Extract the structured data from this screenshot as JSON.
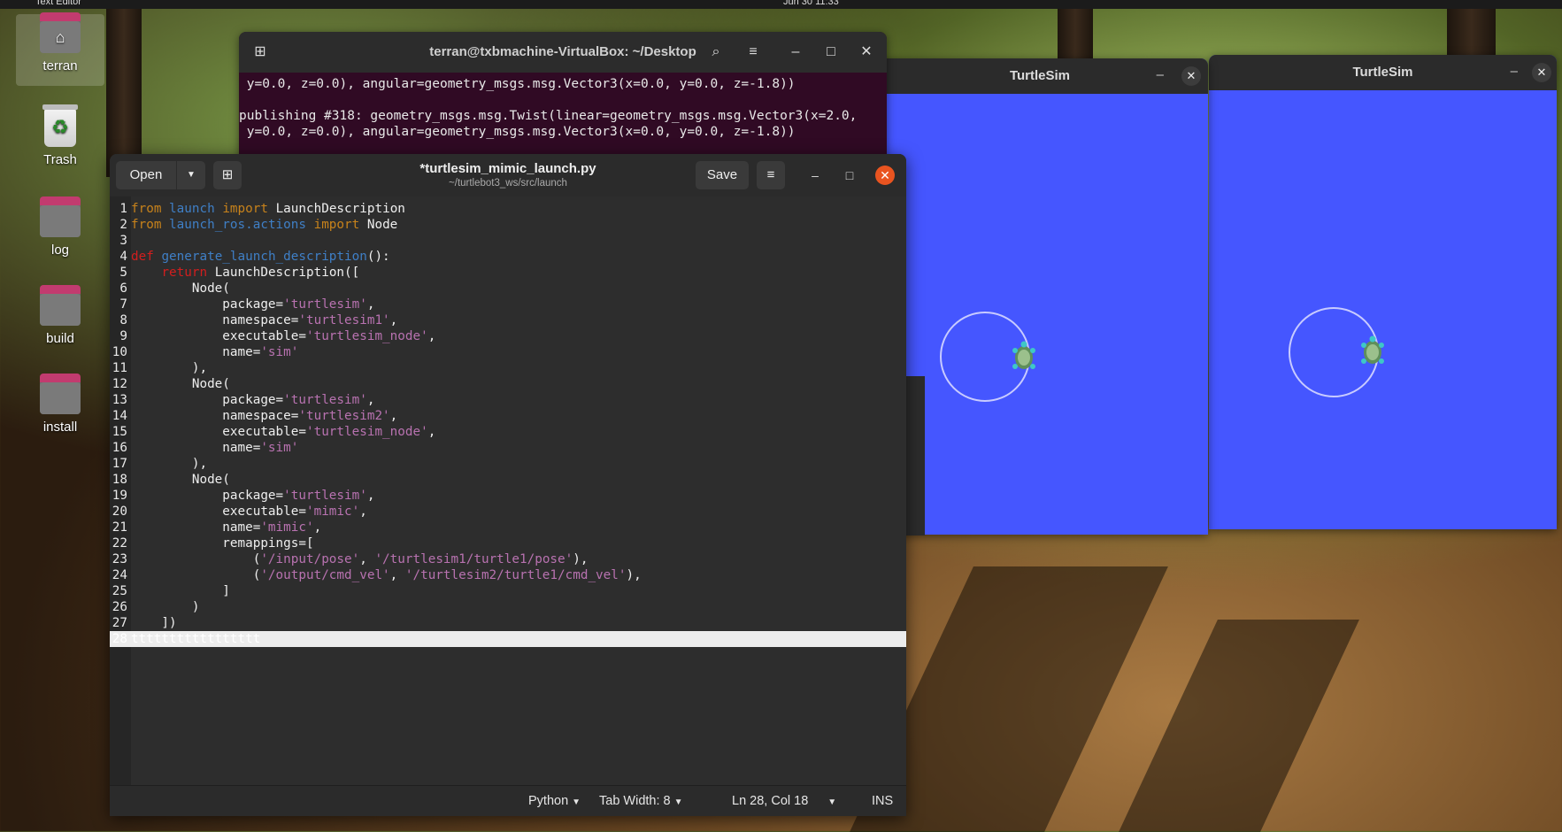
{
  "topbar": {
    "app_name": "Text Editor",
    "clock": "Jun 30  11:33"
  },
  "desktop": {
    "icons": [
      {
        "label": "terran",
        "kind": "home"
      },
      {
        "label": "Trash",
        "kind": "trash"
      },
      {
        "label": "log",
        "kind": "folder"
      },
      {
        "label": "build",
        "kind": "folder"
      },
      {
        "label": "install",
        "kind": "folder"
      }
    ]
  },
  "terminal": {
    "title": "terran@txbmachine-VirtualBox: ~/Desktop",
    "lines": [
      " y=0.0, z=0.0), angular=geometry_msgs.msg.Vector3(x=0.0, y=0.0, z=-1.8))",
      "",
      "publishing #318: geometry_msgs.msg.Twist(linear=geometry_msgs.msg.Vector3(x=2.0,",
      " y=0.0, z=0.0), angular=geometry_msgs.msg.Vector3(x=0.0, y=0.0, z=-1.8))"
    ]
  },
  "turtlesim_windows": [
    {
      "title": "TurtleSim",
      "min_icon": "minimize-icon",
      "close_icon": "close-icon"
    },
    {
      "title": "TurtleSim",
      "min_icon": "minimize-icon",
      "close_icon": "close-icon"
    }
  ],
  "editor": {
    "open_label": "Open",
    "save_label": "Save",
    "title": "*turtlesim_mimic_launch.py",
    "path": "~/turtlebot3_ws/src/launch",
    "current_line_text": "ttttttttttttttttt",
    "line_numbers": [
      "1",
      "2",
      "3",
      "4",
      "5",
      "6",
      "7",
      "8",
      "9",
      "10",
      "11",
      "12",
      "13",
      "14",
      "15",
      "16",
      "17",
      "18",
      "19",
      "20",
      "21",
      "22",
      "23",
      "24",
      "25",
      "26",
      "27",
      "28"
    ],
    "status": {
      "language": "Python",
      "tab_width": "Tab Width: 8",
      "position": "Ln 28, Col 18",
      "mode": "INS"
    }
  },
  "colors": {
    "editor_bg": "#2d2d2d",
    "terminal_bg": "#300a24",
    "turtlesim_bg": "#4556ff",
    "close_accent": "#e95420"
  }
}
